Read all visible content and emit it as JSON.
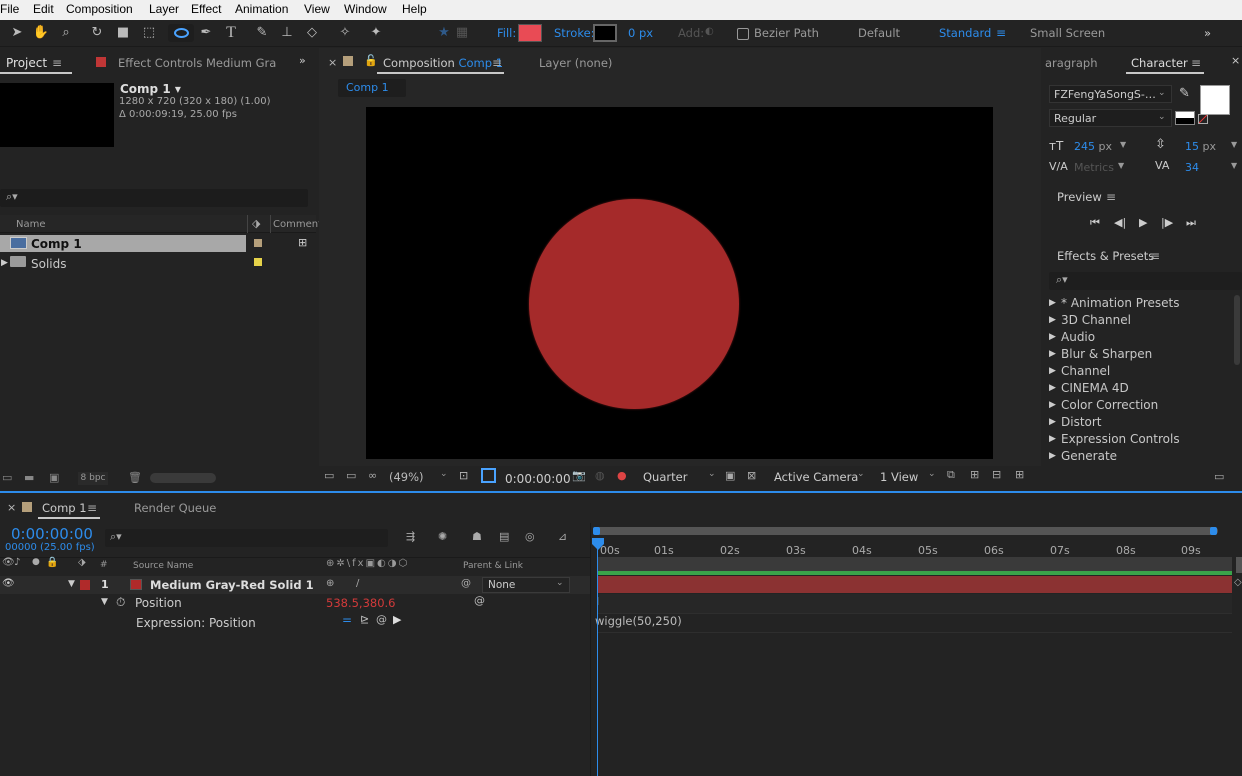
{
  "menu": [
    "File",
    "Edit",
    "Composition",
    "Layer",
    "Effect",
    "Animation",
    "View",
    "Window",
    "Help"
  ],
  "toolbar": {
    "fill_label": "Fill:",
    "stroke_label": "Stroke:",
    "stroke_px": "0 px",
    "add_label": "Add:",
    "bezier_label": "Bezier Path",
    "ws_default": "Default",
    "ws_standard": "Standard",
    "ws_small": "Small Screen",
    "fill_color": "#e94b55",
    "accent": "#2d8ceb"
  },
  "project": {
    "tab": "Project",
    "effect_controls": "Effect Controls Medium Gray-Re",
    "comp_name": "Comp 1 ▾",
    "comp_info1": "1280 x 720  (320 x 180) (1.00)",
    "comp_info2": "Δ 0:00:09:19, 25.00 fps",
    "col_name": "Name",
    "col_comment": "Comment",
    "items": [
      {
        "name": "Comp 1",
        "type": "comp",
        "color": "#b59f7b"
      },
      {
        "name": "Solids",
        "type": "folder",
        "color": "#e6d34a"
      }
    ],
    "bpc": "8 bpc"
  },
  "composition": {
    "tab": "Composition",
    "tab_comp": "Comp 1",
    "layer_tab": "Layer",
    "layer_val": "(none)",
    "sub_tab": "Comp 1",
    "zoom": "(49%)",
    "timecode": "0:00:00:00",
    "quality": "Quarter",
    "camera": "Active Camera",
    "views": "1 View",
    "circle_color": "#a52a2a"
  },
  "character": {
    "tab_paragraph": "aragraph",
    "tab_character": "Character",
    "font": "FZFengYaSongS-…",
    "style": "Regular",
    "size": "245",
    "size_unit": "px",
    "leading": "15",
    "leading_unit": "px",
    "kerning": "Metrics",
    "tracking": "34"
  },
  "preview": {
    "title": "Preview"
  },
  "effects": {
    "title": "Effects & Presets",
    "items": [
      "* Animation Presets",
      "3D Channel",
      "Audio",
      "Blur & Sharpen",
      "Channel",
      "CINEMA 4D",
      "Color Correction",
      "Distort",
      "Expression Controls",
      "Generate"
    ]
  },
  "timeline": {
    "tab": "Comp 1",
    "render_queue": "Render Queue",
    "timecode": "0:00:00:00",
    "frames": "00000 (25.00 fps)",
    "col_num": "#",
    "col_source": "Source Name",
    "col_parent": "Parent & Link",
    "layer_num": "1",
    "layer_name": "Medium Gray-Red Solid 1",
    "parent": "None",
    "position_label": "Position",
    "position_value": "538.5,380.6",
    "expression_label": "Expression: Position",
    "expression": "wiggle(50,250)",
    "ticks": [
      "00s",
      "01s",
      "02s",
      "03s",
      "04s",
      "05s",
      "06s",
      "07s",
      "08s",
      "09s"
    ],
    "layer_color": "#b02a2a",
    "bar_color": "#8b3232"
  }
}
